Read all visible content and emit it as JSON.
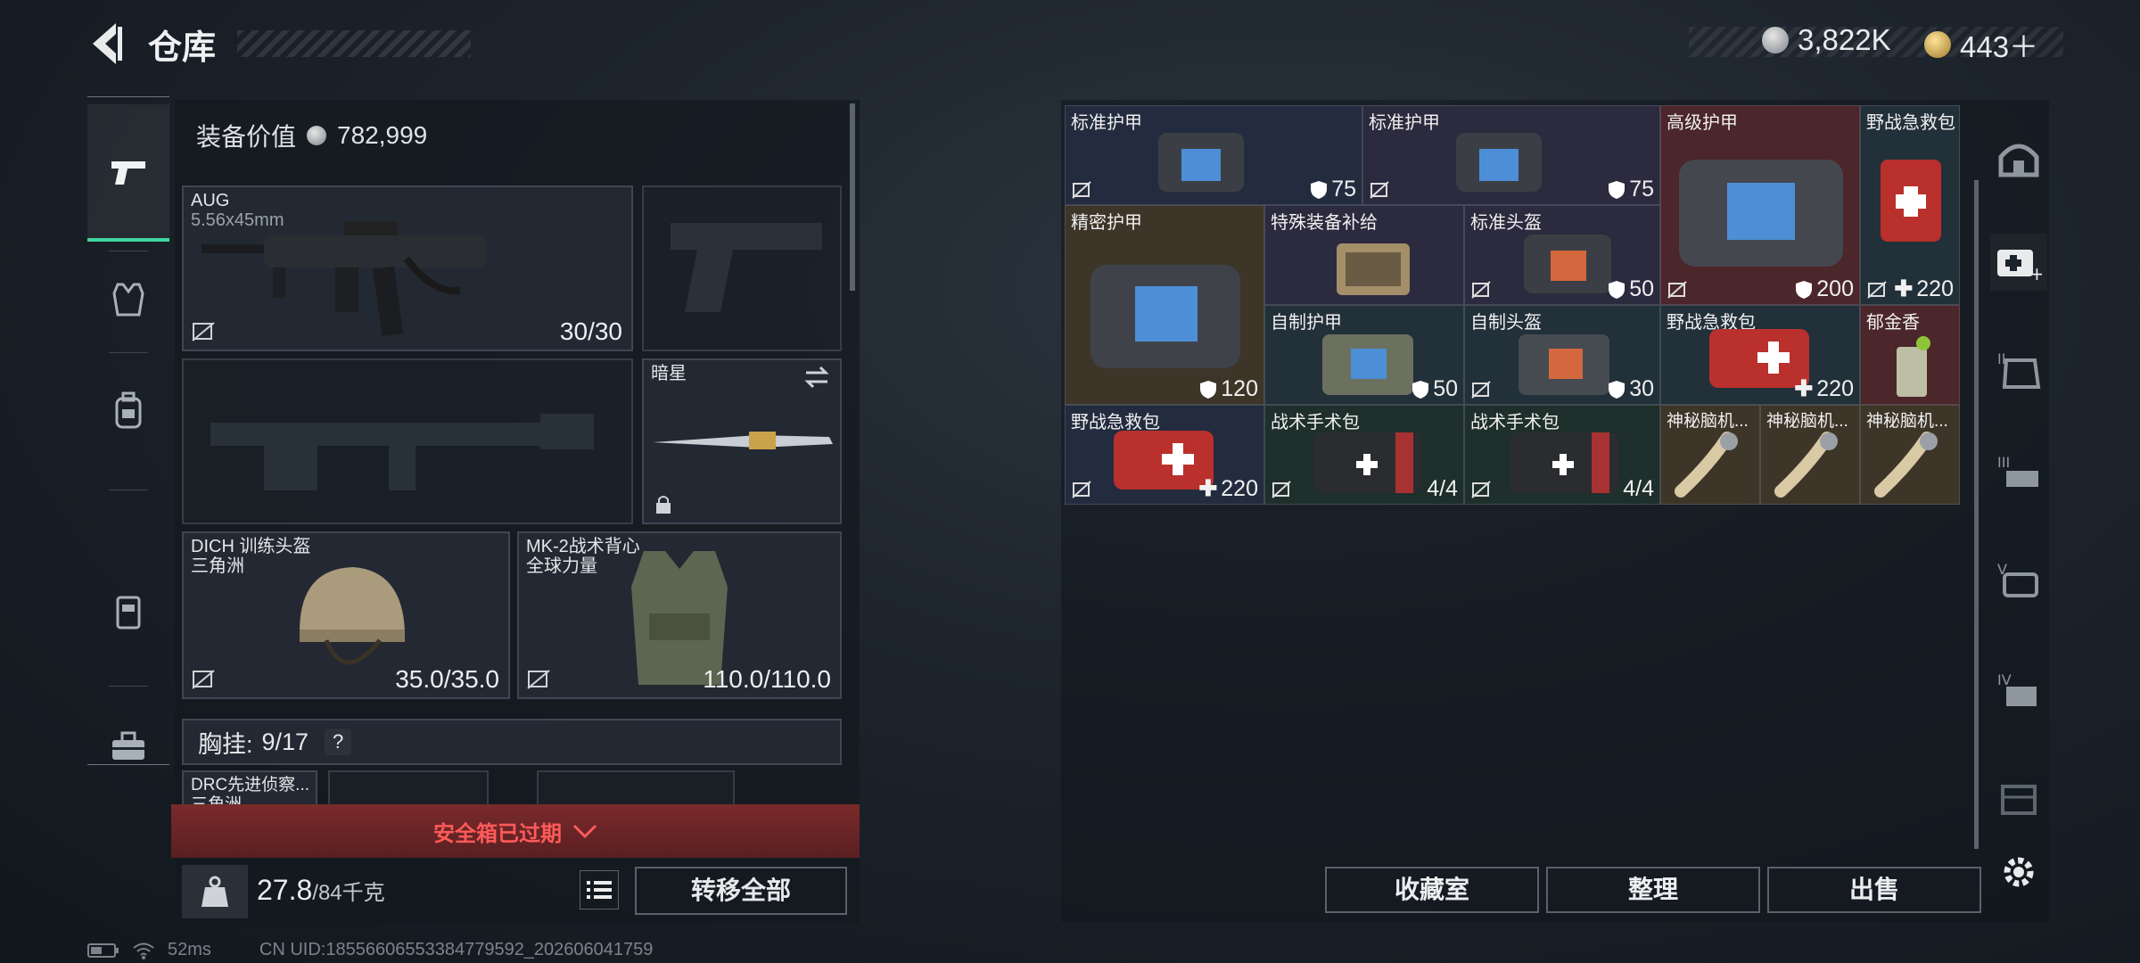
{
  "header": {
    "title": "仓库",
    "currency_silver": "3,822K",
    "currency_gold": "443＋"
  },
  "equipment": {
    "value_label": "装备价值",
    "value": "782,999"
  },
  "slots": {
    "primary": {
      "name": "AUG",
      "caliber": "5.56x45mm",
      "ammo": "30/30"
    },
    "melee": {
      "name": "暗星"
    },
    "helmet": {
      "name": "DICH 训练头盔",
      "brand": "三角洲",
      "durability": "35.0/35.0"
    },
    "armor": {
      "name": "MK-2战术背心",
      "brand": "全球力量",
      "durability": "110.0/110.0"
    }
  },
  "chest_rig": {
    "label": "胸挂:",
    "capacity": "9/17",
    "help": "?"
  },
  "backpack_preview": {
    "item_name": "DRC先进侦察...",
    "item_brand": "三角洲"
  },
  "safe_box": {
    "status": "安全箱已过期"
  },
  "weight": {
    "current": "27.8",
    "max": "/84千克"
  },
  "transfer_all": "转移全部",
  "status_bar": {
    "ping": "52ms",
    "uid": "CN UID:18556606553384779592_202606041759"
  },
  "grid_items": [
    {
      "name": "标准护甲",
      "value": "75"
    },
    {
      "name": "标准护甲",
      "value": "75"
    },
    {
      "name": "高级护甲",
      "value": "200"
    },
    {
      "name": "野战急救包",
      "value": "220"
    },
    {
      "name": "精密护甲",
      "value": "120"
    },
    {
      "name": "特殊装备补给",
      "value": ""
    },
    {
      "name": "标准头盔",
      "value": "50"
    },
    {
      "name": "自制护甲",
      "value": "50"
    },
    {
      "name": "自制头盔",
      "value": "30"
    },
    {
      "name": "野战急救包",
      "value": "220"
    },
    {
      "name": "郁金香",
      "value": ""
    },
    {
      "name": "野战急救包",
      "value": "220"
    },
    {
      "name": "战术手术包",
      "value": "4/4"
    },
    {
      "name": "战术手术包",
      "value": "4/4"
    },
    {
      "name": "神秘脑机...",
      "value": ""
    },
    {
      "name": "神秘脑机...",
      "value": ""
    },
    {
      "name": "神秘脑机...",
      "value": ""
    }
  ],
  "actions": {
    "collection": "收藏室",
    "sort": "整理",
    "sell": "出售"
  },
  "colors": {
    "accent_green": "#3fd6a0",
    "warning_red": "#ff5a5a",
    "safe_bar": "#6e2626"
  }
}
